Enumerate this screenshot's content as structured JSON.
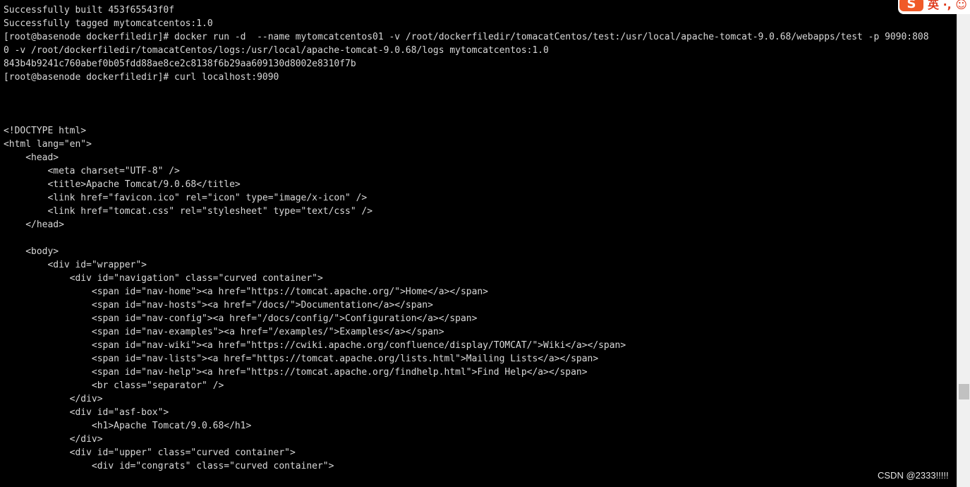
{
  "terminal": {
    "lines": [
      "Successfully built 453f65543f0f",
      "Successfully tagged mytomcatcentos:1.0",
      "[root@basenode dockerfiledir]# docker run -d  --name mytomcatcentos01 -v /root/dockerfiledir/tomacatCentos/test:/usr/local/apache-tomcat-9.0.68/webapps/test -p 9090:808",
      "0 -v /root/dockerfiledir/tomacatCentos/logs:/usr/local/apache-tomcat-9.0.68/logs mytomcatcentos:1.0",
      "843b4b9241c760abef0b05fdd88ae8ce2c8138f6b29aa609130d8002e8310f7b",
      "[root@basenode dockerfiledir]# curl localhost:9090",
      "",
      "",
      "",
      "<!DOCTYPE html>",
      "<html lang=\"en\">",
      "    <head>",
      "        <meta charset=\"UTF-8\" />",
      "        <title>Apache Tomcat/9.0.68</title>",
      "        <link href=\"favicon.ico\" rel=\"icon\" type=\"image/x-icon\" />",
      "        <link href=\"tomcat.css\" rel=\"stylesheet\" type=\"text/css\" />",
      "    </head>",
      "",
      "    <body>",
      "        <div id=\"wrapper\">",
      "            <div id=\"navigation\" class=\"curved container\">",
      "                <span id=\"nav-home\"><a href=\"https://tomcat.apache.org/\">Home</a></span>",
      "                <span id=\"nav-hosts\"><a href=\"/docs/\">Documentation</a></span>",
      "                <span id=\"nav-config\"><a href=\"/docs/config/\">Configuration</a></span>",
      "                <span id=\"nav-examples\"><a href=\"/examples/\">Examples</a></span>",
      "                <span id=\"nav-wiki\"><a href=\"https://cwiki.apache.org/confluence/display/TOMCAT/\">Wiki</a></span>",
      "                <span id=\"nav-lists\"><a href=\"https://tomcat.apache.org/lists.html\">Mailing Lists</a></span>",
      "                <span id=\"nav-help\"><a href=\"https://tomcat.apache.org/findhelp.html\">Find Help</a></span>",
      "                <br class=\"separator\" />",
      "            </div>",
      "            <div id=\"asf-box\">",
      "                <h1>Apache Tomcat/9.0.68</h1>",
      "            </div>",
      "            <div id=\"upper\" class=\"curved container\">",
      "                <div id=\"congrats\" class=\"curved container\">"
    ]
  },
  "ime": {
    "logo": "S",
    "label": "英 ·, ☺",
    "icon": "sogou-ime-icon"
  },
  "watermark": {
    "text": "CSDN @2333!!!!!"
  },
  "colors": {
    "background": "#000000",
    "text": "#d8d8d8",
    "ime_brand": "#f05a28"
  }
}
